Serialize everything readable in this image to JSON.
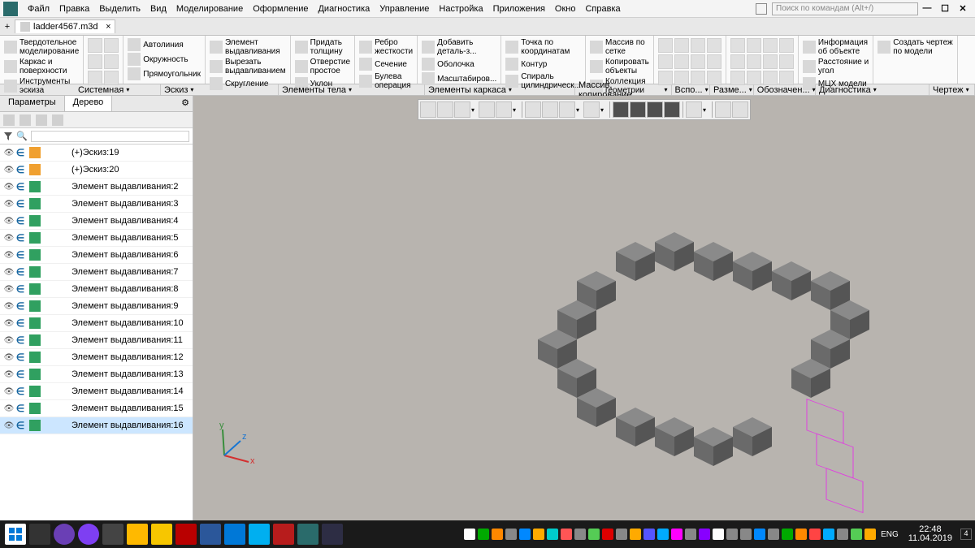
{
  "menubar": {
    "items": [
      "Файл",
      "Правка",
      "Выделить",
      "Вид",
      "Моделирование",
      "Оформление",
      "Диагностика",
      "Управление",
      "Настройка",
      "Приложения",
      "Окно",
      "Справка"
    ],
    "search_placeholder": "Поиск по командам (Alt+/)"
  },
  "tab": {
    "name": "ladder4567.m3d"
  },
  "ribbon_groups": [
    {
      "items": [
        {
          "label": "Твердотельное\nмоделирование"
        },
        {
          "label": "Каркас и\nповерхности"
        },
        {
          "label": "Инструменты\nэскиза"
        }
      ]
    },
    {
      "icons": 6
    },
    {
      "items": [
        {
          "label": "Автолиния"
        },
        {
          "label": "Окружность"
        },
        {
          "label": "Прямоугольник"
        }
      ]
    },
    {
      "items": [
        {
          "label": "Элемент\nвыдавливания"
        },
        {
          "label": "Вырезать\nвыдавливанием"
        },
        {
          "label": "Скругление"
        }
      ]
    },
    {
      "items": [
        {
          "label": "Придать\nтолщину"
        },
        {
          "label": "Отверстие\nпростое"
        },
        {
          "label": "Уклон"
        }
      ]
    },
    {
      "items": [
        {
          "label": "Ребро\nжесткости"
        },
        {
          "label": "Сечение"
        },
        {
          "label": "Булева\nоперация"
        }
      ]
    },
    {
      "items": [
        {
          "label": "Добавить\nдеталь-з..."
        },
        {
          "label": "Оболочка"
        },
        {
          "label": "Масштабиров..."
        }
      ]
    },
    {
      "items": [
        {
          "label": "Точка по\nкоординатам"
        },
        {
          "label": "Контур"
        },
        {
          "label": "Спираль\nцилиндрическ..."
        }
      ]
    },
    {
      "items": [
        {
          "label": "Массив по\nсетке"
        },
        {
          "label": "Копировать\nобъекты"
        },
        {
          "label": "Коллекция\nгеометрии"
        }
      ]
    },
    {
      "icons": 12
    },
    {
      "icons": 12
    },
    {
      "items": [
        {
          "label": "Информация\nоб объекте"
        },
        {
          "label": "Расстояние и\nугол"
        },
        {
          "label": "МЦХ модели"
        }
      ]
    },
    {
      "items": [
        {
          "label": "Создать чертеж\nпо модели"
        }
      ]
    }
  ],
  "ribbon_cats": [
    "Системная",
    "Эскиз",
    "Элементы тела",
    "Элементы каркаса",
    "Массив, копирование",
    "Вспо...",
    "Разме...",
    "Обозначен...",
    "Диагностика",
    "Чертеж"
  ],
  "sidepanel": {
    "tabs": [
      "Параметры",
      "Дерево"
    ],
    "active": 1
  },
  "tree_items": [
    {
      "name": "(+)Эскиз:19",
      "type": "sketch"
    },
    {
      "name": "(+)Эскиз:20",
      "type": "sketch"
    },
    {
      "name": "Элемент выдавливания:2",
      "type": "extrude"
    },
    {
      "name": "Элемент выдавливания:3",
      "type": "extrude"
    },
    {
      "name": "Элемент выдавливания:4",
      "type": "extrude"
    },
    {
      "name": "Элемент выдавливания:5",
      "type": "extrude"
    },
    {
      "name": "Элемент выдавливания:6",
      "type": "extrude"
    },
    {
      "name": "Элемент выдавливания:7",
      "type": "extrude"
    },
    {
      "name": "Элемент выдавливания:8",
      "type": "extrude"
    },
    {
      "name": "Элемент выдавливания:9",
      "type": "extrude"
    },
    {
      "name": "Элемент выдавливания:10",
      "type": "extrude"
    },
    {
      "name": "Элемент выдавливания:11",
      "type": "extrude"
    },
    {
      "name": "Элемент выдавливания:12",
      "type": "extrude"
    },
    {
      "name": "Элемент выдавливания:13",
      "type": "extrude"
    },
    {
      "name": "Элемент выдавливания:14",
      "type": "extrude"
    },
    {
      "name": "Элемент выдавливания:15",
      "type": "extrude"
    },
    {
      "name": "Элемент выдавливания:16",
      "type": "extrude",
      "selected": true
    }
  ],
  "status": {
    "lang": "ENG",
    "time": "22:48",
    "date": "11.04.2019"
  },
  "axes": [
    "x",
    "y",
    "z"
  ]
}
